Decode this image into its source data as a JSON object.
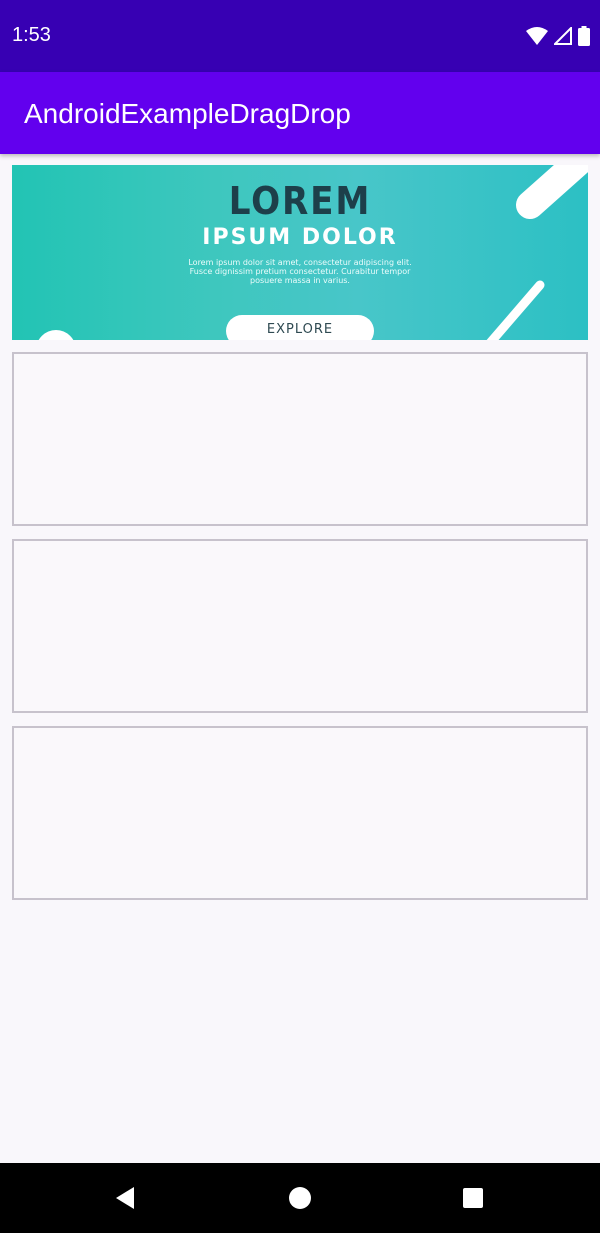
{
  "status_bar": {
    "time": "1:53",
    "icons": [
      "wifi-icon",
      "signal-icon",
      "battery-icon"
    ],
    "background": "#3700b3"
  },
  "app_bar": {
    "title": "AndroidExampleDragDrop",
    "background": "#6200ee"
  },
  "banner": {
    "title": "LOREM",
    "subtitle": "IPSUM DOLOR",
    "body": "Lorem ipsum dolor sit amet, consectetur adipiscing elit. Fusce dignissim pretium consectetur. Curabitur tempor posuere massa in varius.",
    "button_label": "EXPLORE",
    "gradient": [
      "#22c4b4",
      "#48c6c9"
    ]
  },
  "drop_zones": [
    {
      "label": ""
    },
    {
      "label": ""
    },
    {
      "label": ""
    }
  ],
  "nav_bar": {
    "buttons": [
      "back-icon",
      "home-icon",
      "recents-icon"
    ]
  }
}
